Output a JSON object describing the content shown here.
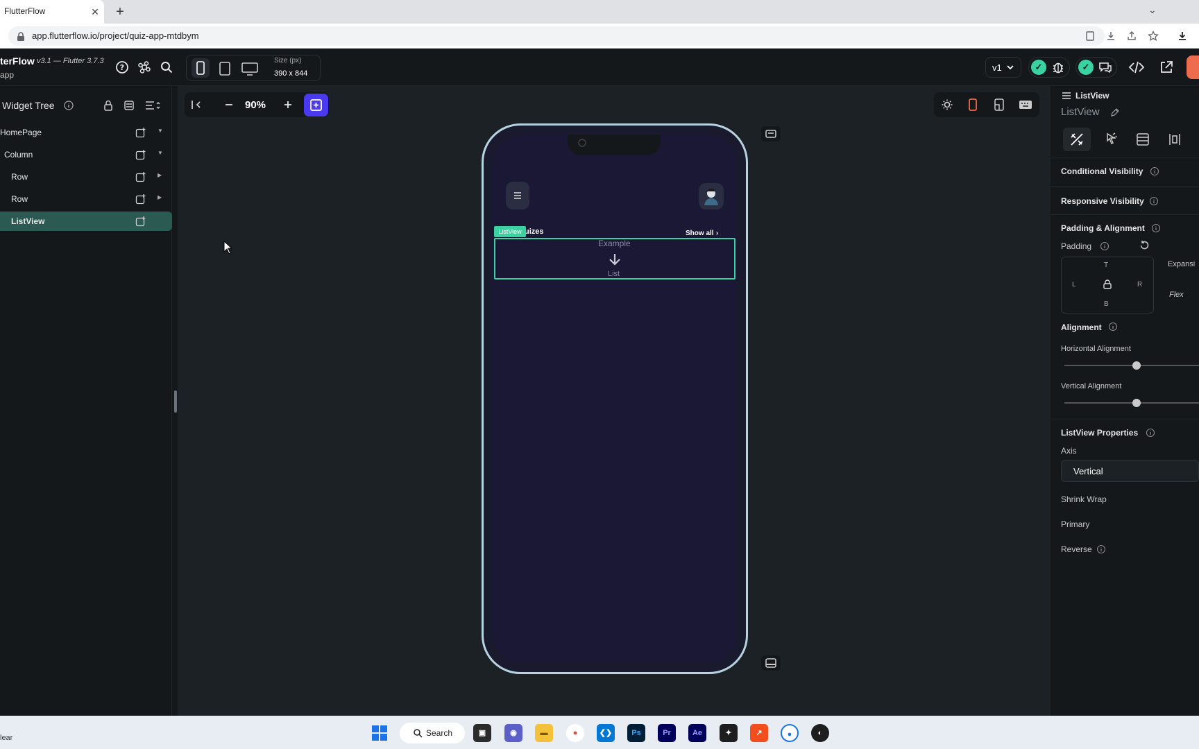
{
  "browser": {
    "tab_title": "FlutterFlow",
    "tab_close": "✕",
    "new_tab": "+",
    "url": "app.flutterflow.io/project/quiz-app-mtdbym"
  },
  "topbar": {
    "app_title": "terFlow",
    "version": "v3.1 — Flutter 3.7.3",
    "sub": "app",
    "size_label": "Size (px)",
    "size_value": "390 x 844",
    "branch": "v1"
  },
  "widget_tree": {
    "title": "Widget Tree",
    "items": [
      {
        "label": "HomePage",
        "indent": 0
      },
      {
        "label": "Column",
        "indent": 1
      },
      {
        "label": "Row",
        "indent": 2
      },
      {
        "label": "Row",
        "indent": 2
      },
      {
        "label": "ListView",
        "indent": 2,
        "selected": true
      }
    ]
  },
  "canvas": {
    "zoom": "90%",
    "phone": {
      "section_title": "uizes",
      "show_all": "Show all",
      "badge": "ListView",
      "example": "Example",
      "list": "List"
    }
  },
  "properties": {
    "widget_type": "ListView",
    "widget_name": "ListView",
    "conditional_visibility": "Conditional Visibility",
    "responsive_visibility": "Responsive Visibility",
    "padding_alignment": "Padding & Alignment",
    "padding": "Padding",
    "pad_t": "T",
    "pad_l": "L",
    "pad_r": "R",
    "pad_b": "B",
    "expansion": "Expansi",
    "flex": "Flex",
    "alignment": "Alignment",
    "horizontal_alignment": "Horizontal Alignment",
    "vertical_alignment": "Vertical Alignment",
    "listview_properties": "ListView Properties",
    "axis": "Axis",
    "axis_value": "Vertical",
    "shrink_wrap": "Shrink Wrap",
    "primary": "Primary",
    "reverse": "Reverse"
  },
  "taskbar": {
    "status": "lear",
    "search": "Search",
    "apps": [
      "Ps",
      "Pr",
      "Ae"
    ]
  },
  "colors": {
    "accent": "#4b39ef",
    "selection": "#39d2a0",
    "canvas_bg": "#1b2125"
  }
}
